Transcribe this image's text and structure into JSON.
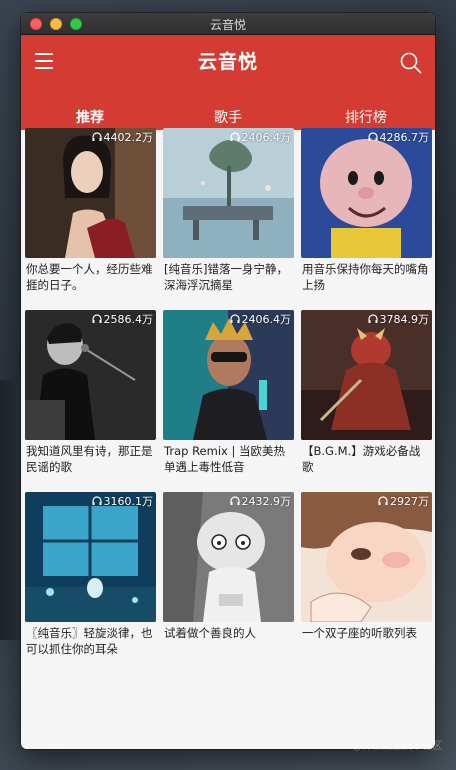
{
  "window": {
    "title": "云音悦"
  },
  "header": {
    "title": "云音悦"
  },
  "tabs": [
    {
      "label": "推荐",
      "active": true
    },
    {
      "label": "歌手",
      "active": false
    },
    {
      "label": "排行榜",
      "active": false
    }
  ],
  "playlists": [
    {
      "plays": "4402.2万",
      "title": "你总要一个人，经历些难捱的日子。"
    },
    {
      "plays": "2406.4万",
      "title": "[纯音乐]错落一身宁静，深海浮沉摘星"
    },
    {
      "plays": "4286.7万",
      "title": "用音乐保持你每天的嘴角上扬"
    },
    {
      "plays": "2586.4万",
      "title": "我知道风里有诗，那正是民谣的歌"
    },
    {
      "plays": "2406.4万",
      "title": "Trap Remix | 当欧美热单遇上毒性低音"
    },
    {
      "plays": "3784.9万",
      "title": "【B.G.M.】游戏必备战歌"
    },
    {
      "plays": "3160.1万",
      "title": "〖纯音乐〗轻旋淡律，也可以抓住你的耳朵"
    },
    {
      "plays": "2432.9万",
      "title": "试着做个善良的人"
    },
    {
      "plays": "2927万",
      "title": "一个双子座的听歌列表"
    }
  ],
  "watermark": "@稀土掘金技术社区",
  "colors": {
    "brand": "#d43c33",
    "background": "#f5f5f5"
  }
}
